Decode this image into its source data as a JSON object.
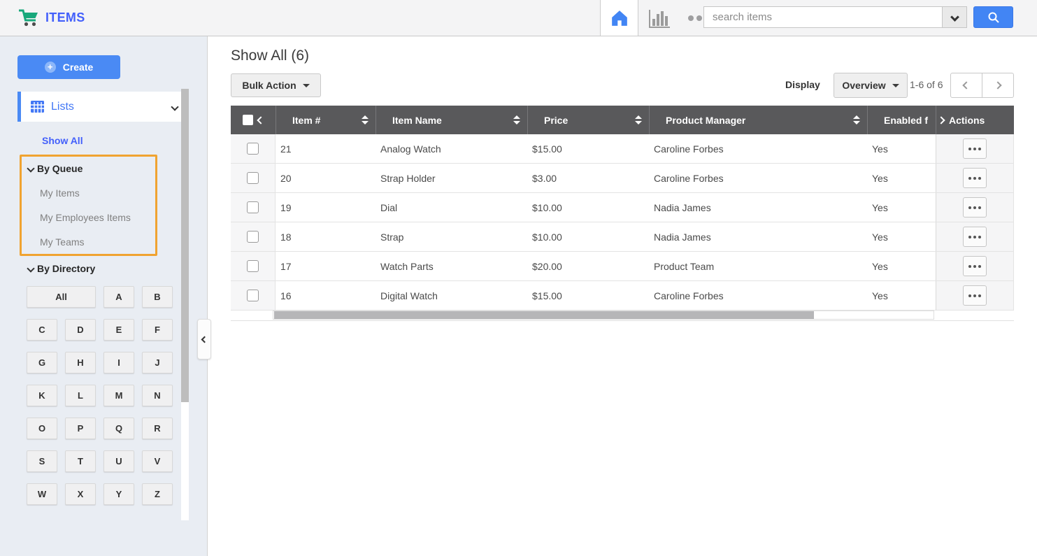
{
  "topbar": {
    "app_title": "ITEMS",
    "search_placeholder": "search items"
  },
  "sidebar": {
    "create_label": "Create",
    "lists_label": "Lists",
    "show_all_label": "Show All",
    "by_queue": {
      "label": "By Queue",
      "items": [
        "My Items",
        "My Employees Items",
        "My Teams"
      ]
    },
    "by_directory": {
      "label": "By Directory",
      "letters": [
        "All",
        "A",
        "B",
        "C",
        "D",
        "E",
        "F",
        "G",
        "H",
        "I",
        "J",
        "K",
        "L",
        "M",
        "N",
        "O",
        "P",
        "Q",
        "R",
        "S",
        "T",
        "U",
        "V",
        "W",
        "X",
        "Y",
        "Z"
      ]
    }
  },
  "main": {
    "title": "Show All (6)",
    "bulk_action_label": "Bulk Action",
    "display_label": "Display",
    "display_value": "Overview",
    "range_text": "1-6 of 6",
    "table": {
      "columns": [
        "Item #",
        "Item Name",
        "Price",
        "Product Manager",
        "Enabled f",
        "Actions"
      ],
      "rows": [
        {
          "item_no": "21",
          "item_name": "Analog Watch",
          "price": "$15.00",
          "product_manager": "Caroline Forbes",
          "enabled": "Yes"
        },
        {
          "item_no": "20",
          "item_name": "Strap Holder",
          "price": "$3.00",
          "product_manager": "Caroline Forbes",
          "enabled": "Yes"
        },
        {
          "item_no": "19",
          "item_name": "Dial",
          "price": "$10.00",
          "product_manager": "Nadia James",
          "enabled": "Yes"
        },
        {
          "item_no": "18",
          "item_name": "Strap",
          "price": "$10.00",
          "product_manager": "Nadia James",
          "enabled": "Yes"
        },
        {
          "item_no": "17",
          "item_name": "Watch Parts",
          "price": "$20.00",
          "product_manager": "Product Team",
          "enabled": "Yes"
        },
        {
          "item_no": "16",
          "item_name": "Digital Watch",
          "price": "$15.00",
          "product_manager": "Caroline Forbes",
          "enabled": "Yes"
        }
      ]
    }
  },
  "colors": {
    "accent_text_blue": "#4360fb",
    "button_blue": "#4a8af4",
    "search_blue": "#4285f4",
    "cart_green": "#18a87b",
    "highlight_orange": "#f0a330",
    "table_header_gray": "#59595b"
  }
}
